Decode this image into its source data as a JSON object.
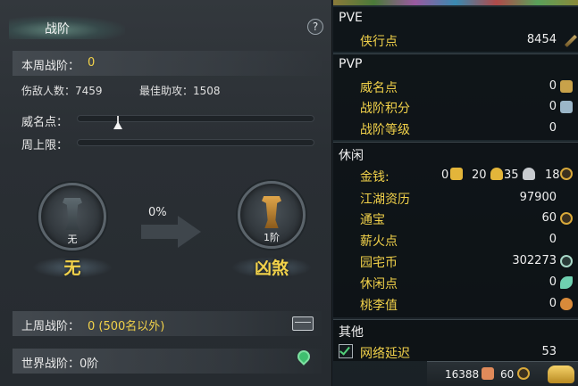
{
  "left": {
    "title": "战阶",
    "help_symbol": "?",
    "weekly_rank_label": "本周战阶：",
    "weekly_rank_value": "0",
    "kills_label": "伤敌人数：7459",
    "assists_label": "最佳助攻：1508",
    "fame_label": "威名点：",
    "weekly_cap_label": "周上限：",
    "fame_progress": 0.17,
    "weekly_cap_progress": 0.0,
    "current_rank": {
      "level": "无",
      "name": "无"
    },
    "next_rank": {
      "level": "1阶",
      "name": "凶煞"
    },
    "progress_percent": "0%",
    "last_week_label": "上周战阶：",
    "last_week_value": "0 (500名以外)",
    "world_rank_label": "世界战阶：0阶"
  },
  "right": {
    "pve": {
      "header": "PVE",
      "items": [
        {
          "label": "侠行点",
          "value": "8454",
          "icon": "sword-icon"
        }
      ]
    },
    "pvp": {
      "header": "PVP",
      "items": [
        {
          "label": "威名点",
          "value": "0",
          "icon": "mask-icon"
        },
        {
          "label": "战阶积分",
          "value": "0",
          "icon": "trophy-icon"
        },
        {
          "label": "战阶等级",
          "value": "0"
        }
      ]
    },
    "leisure": {
      "header": "休闲",
      "money_label": "金钱:",
      "money_values": [
        "0",
        "20",
        "35",
        "18"
      ],
      "items": [
        {
          "label": "江湖资历",
          "value": "97900"
        },
        {
          "label": "通宝",
          "value": "60",
          "icon": "coin-icon"
        },
        {
          "label": "薪火点",
          "value": "0"
        },
        {
          "label": "园宅币",
          "value": "302273",
          "icon": "house-coin-icon"
        },
        {
          "label": "休闲点",
          "value": "0",
          "icon": "leaf-icon"
        },
        {
          "label": "桃李值",
          "value": "0",
          "icon": "gourd-icon"
        }
      ]
    },
    "other": {
      "header": "其他",
      "network_label": "网络延迟",
      "network_value": "53",
      "network_checked": true
    }
  },
  "bottom_bar": {
    "points": "16388",
    "coins": "60"
  },
  "colors": {
    "accent_yellow": "#f2d24a",
    "panel_bg": "#2a2f34",
    "check_green": "#52d07a"
  }
}
